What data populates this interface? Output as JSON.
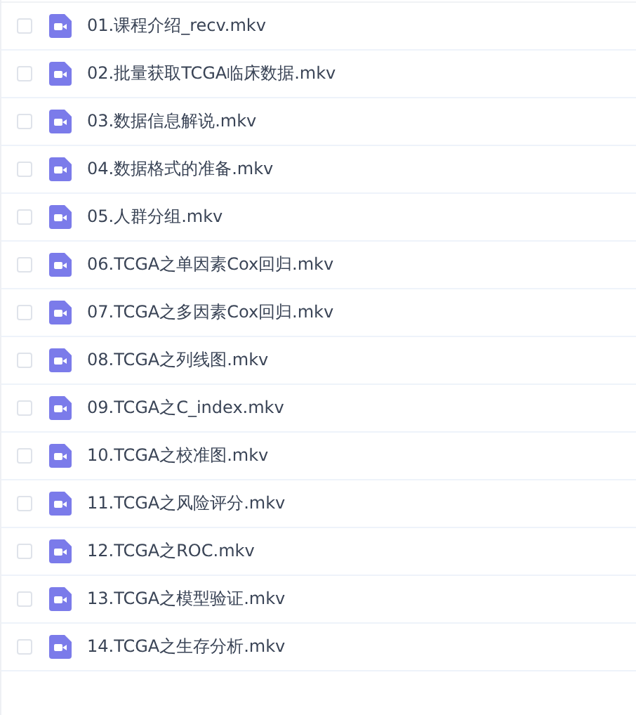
{
  "files": [
    {
      "name": "01.课程介绍_recv.mkv",
      "checked": false
    },
    {
      "name": "02.批量获取TCGA临床数据.mkv",
      "checked": false
    },
    {
      "name": "03.数据信息解说.mkv",
      "checked": false
    },
    {
      "name": "04.数据格式的准备.mkv",
      "checked": false
    },
    {
      "name": "05.人群分组.mkv",
      "checked": false
    },
    {
      "name": "06.TCGA之单因素Cox回归.mkv",
      "checked": false
    },
    {
      "name": "07.TCGA之多因素Cox回归.mkv",
      "checked": false
    },
    {
      "name": "08.TCGA之列线图.mkv",
      "checked": false
    },
    {
      "name": "09.TCGA之C_index.mkv",
      "checked": false
    },
    {
      "name": "10.TCGA之校准图.mkv",
      "checked": false
    },
    {
      "name": "11.TCGA之风险评分.mkv",
      "checked": false
    },
    {
      "name": "12.TCGA之ROC.mkv",
      "checked": false
    },
    {
      "name": "13.TCGA之模型验证.mkv",
      "checked": false
    },
    {
      "name": "14.TCGA之生存分析.mkv",
      "checked": false
    }
  ]
}
